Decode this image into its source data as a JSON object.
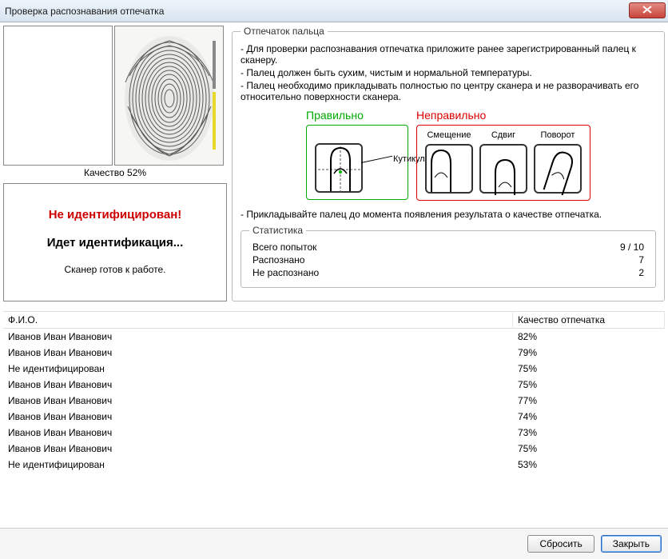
{
  "window": {
    "title": "Проверка распознавания отпечатка"
  },
  "left": {
    "quality_label": "Качество 52%",
    "not_identified": "Не идентифицирован!",
    "identifying": "Идет идентификация...",
    "scanner_ready": "Сканер готов к работе."
  },
  "instructions": {
    "legend": "Отпечаток пальца",
    "line1": "- Для проверки распознавания отпечатка приложите ранее зарегистрированный палец к сканеру.",
    "line2": "- Палец должен быть сухим, чистым и нормальной температуры.",
    "line3": "- Палец необходимо прикладывать полностью по центру сканера и не разворачивать его относительно поверхности сканера.",
    "line4": "- Прикладывайте палец до момента появления результата о качестве отпечатка.",
    "correct_title": "Правильно",
    "wrong_title": "Неправильно",
    "cuticle": "Кутикула",
    "wrong_labels": [
      "Смещение",
      "Сдвиг",
      "Поворот"
    ]
  },
  "stats": {
    "legend": "Статистика",
    "attempts_label": "Всего попыток",
    "attempts_value": "9 / 10",
    "recognized_label": "Распознано",
    "recognized_value": "7",
    "unrecognized_label": "Не распознано",
    "unrecognized_value": "2"
  },
  "table": {
    "col_name": "Ф.И.О.",
    "col_quality": "Качество отпечатка",
    "rows": [
      {
        "name": "Иванов Иван Иванович",
        "quality": "82%"
      },
      {
        "name": "Иванов Иван Иванович",
        "quality": "79%"
      },
      {
        "name": "Не идентифицирован",
        "quality": "75%"
      },
      {
        "name": "Иванов Иван Иванович",
        "quality": "75%"
      },
      {
        "name": "Иванов Иван Иванович",
        "quality": "77%"
      },
      {
        "name": "Иванов Иван Иванович",
        "quality": "74%"
      },
      {
        "name": "Иванов Иван Иванович",
        "quality": "73%"
      },
      {
        "name": "Иванов Иван Иванович",
        "quality": "75%"
      },
      {
        "name": "Не идентифицирован",
        "quality": "53%"
      }
    ]
  },
  "footer": {
    "reset": "Сбросить",
    "close": "Закрыть"
  }
}
